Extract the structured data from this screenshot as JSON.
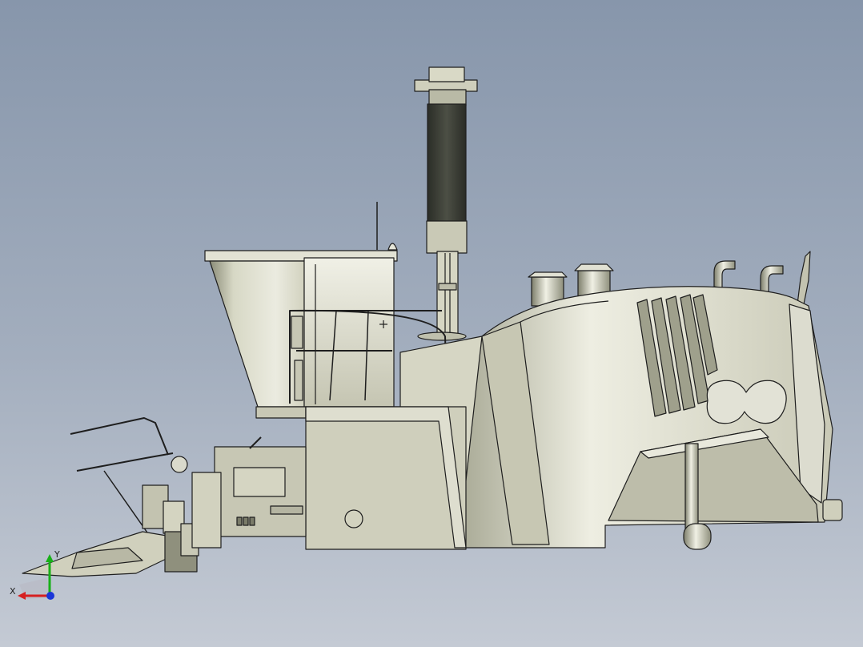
{
  "viewport": {
    "background_top": "#8796ab",
    "background_bottom": "#c4cad4"
  },
  "model": {
    "body_color": "#d9d9c6",
    "edge_color": "#1e1e1e",
    "shadow_color": "#6f705f"
  },
  "triad": {
    "x_label": "X",
    "y_label": "Y",
    "x_color": "#d62020",
    "y_color": "#18b018",
    "z_color": "#1a36d8"
  }
}
